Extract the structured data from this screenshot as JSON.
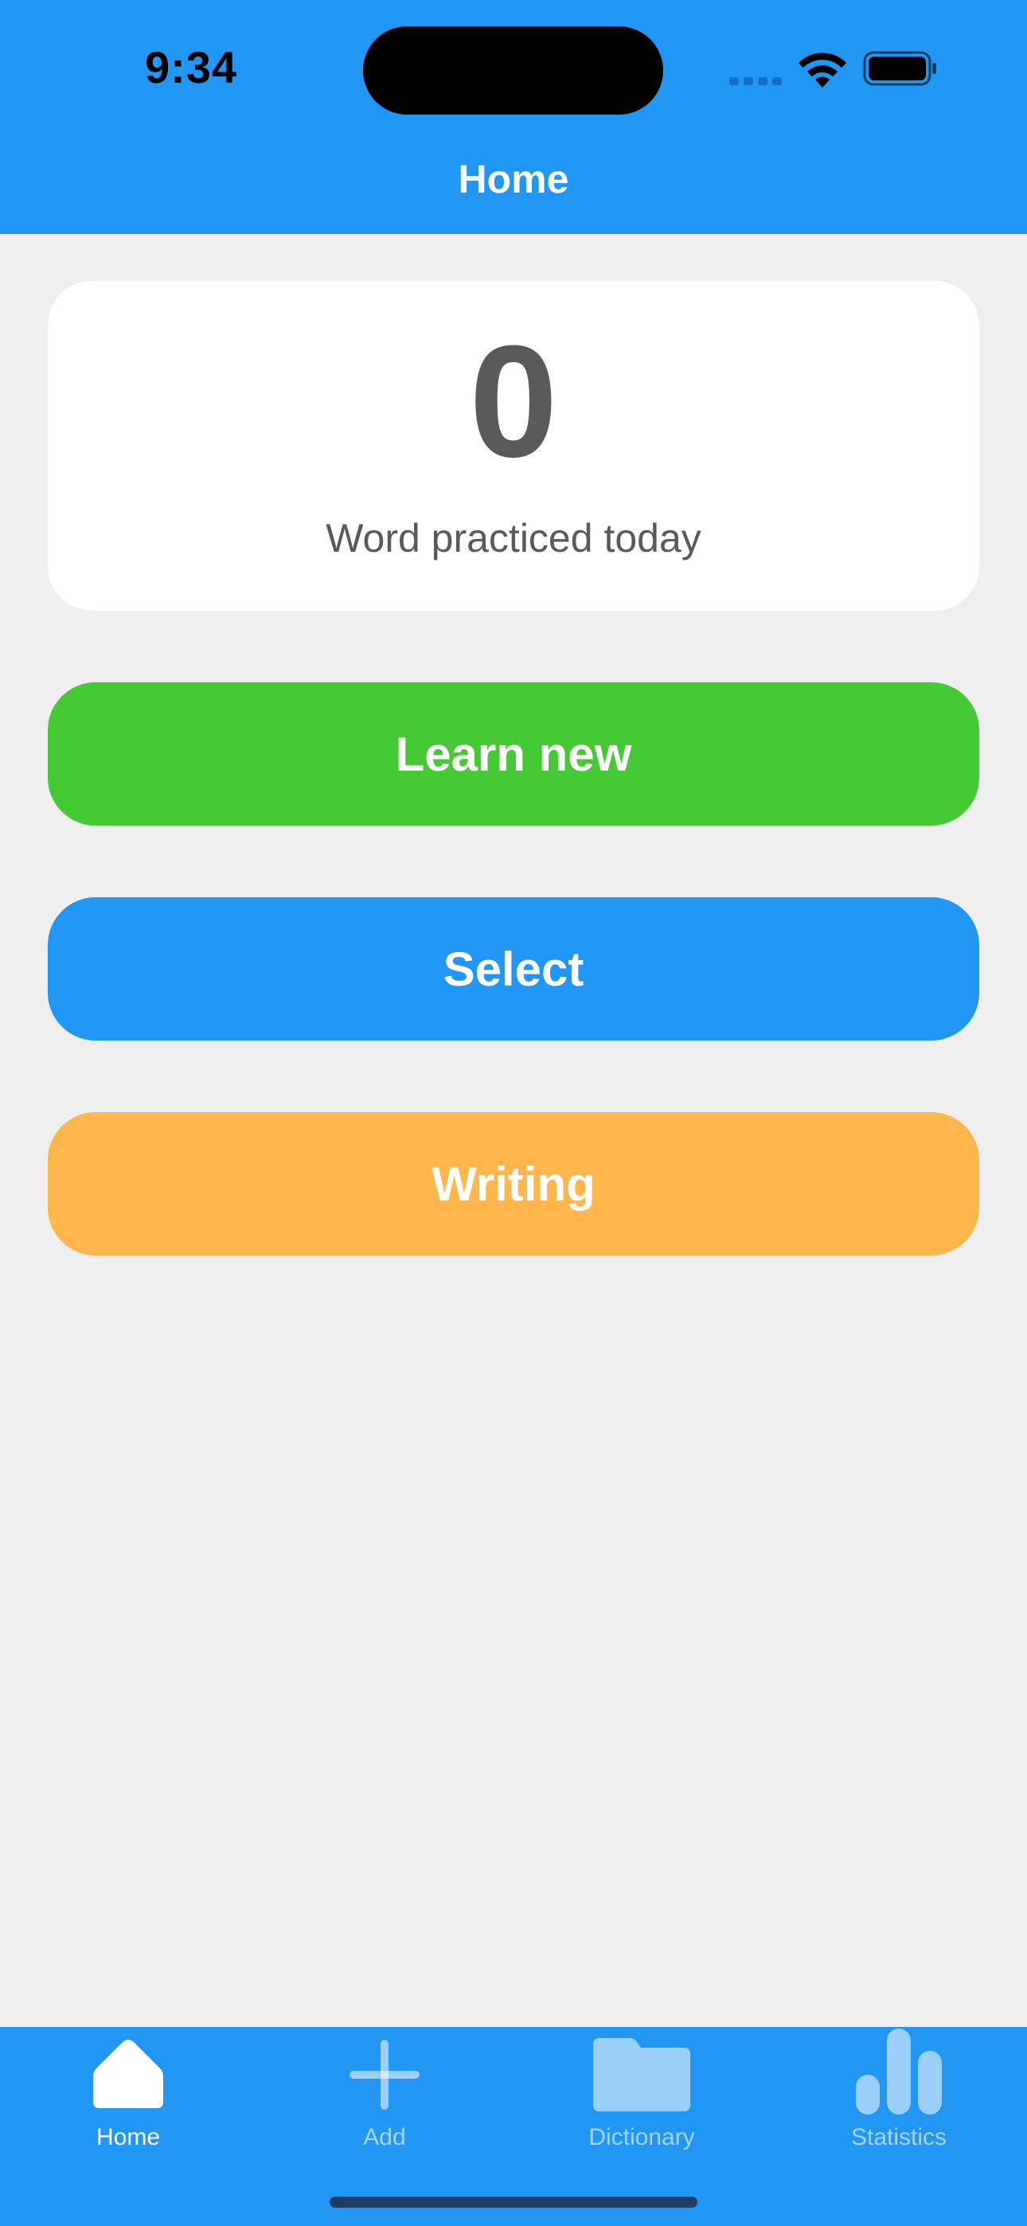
{
  "status_bar": {
    "time": "9:34"
  },
  "nav": {
    "title": "Home"
  },
  "stats": {
    "count": "0",
    "caption": "Word practiced today"
  },
  "actions": {
    "learn_new": "Learn new",
    "select": "Select",
    "writing": "Writing"
  },
  "tab_bar": {
    "items": [
      {
        "label": "Home",
        "icon": "home-icon",
        "active": true
      },
      {
        "label": "Add",
        "icon": "plus-icon",
        "active": false
      },
      {
        "label": "Dictionary",
        "icon": "folder-icon",
        "active": false
      },
      {
        "label": "Statistics",
        "icon": "bar-chart-icon",
        "active": false
      }
    ]
  },
  "colors": {
    "primary_blue": "#2196f3",
    "learn_green": "#45c935",
    "writing_orange": "#ffb74d",
    "background": "#efefef",
    "card_text": "#5a5a5a"
  }
}
